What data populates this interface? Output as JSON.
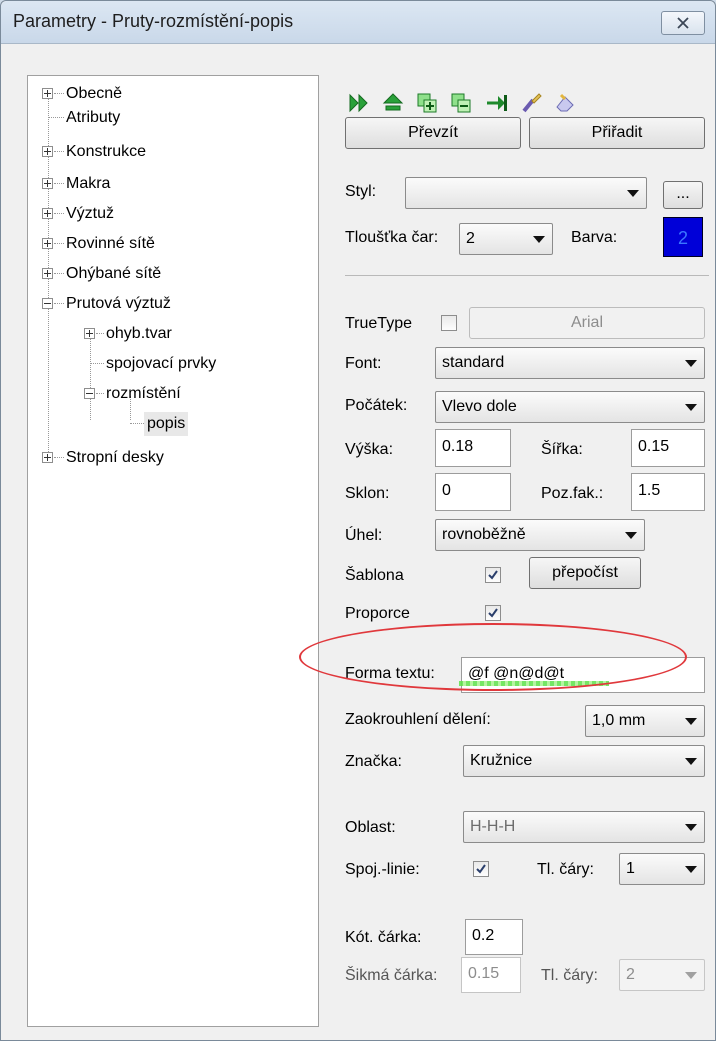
{
  "window": {
    "title": "Parametry - Pruty-rozmístění-popis",
    "close_icon": "close-icon"
  },
  "tree": {
    "items": [
      {
        "label": "Obecně"
      },
      {
        "label": "Atributy"
      },
      {
        "label": "Konstrukce"
      },
      {
        "label": "Makra"
      },
      {
        "label": "Výztuž"
      },
      {
        "label": "Rovinné sítě"
      },
      {
        "label": "Ohýbané sítě"
      },
      {
        "label": "Prutová výztuž"
      },
      {
        "label": "ohyb.tvar"
      },
      {
        "label": "spojovací prvky"
      },
      {
        "label": "rozmístění"
      },
      {
        "label": "popis"
      },
      {
        "label": "Stropní desky"
      }
    ]
  },
  "toolbar": {
    "icons": [
      "double-arrow-right-icon",
      "move-top-icon",
      "add-grid-icon",
      "remove-grid-icon",
      "pin-icon",
      "brush-icon",
      "eraser-icon"
    ]
  },
  "buttons": {
    "prevzit": "Převzít",
    "priradit": "Přiřadit",
    "ellipsis": "...",
    "arial": "Arial",
    "prepocist": "přepočíst"
  },
  "style": {
    "label": "Styl:",
    "value": ""
  },
  "line_thickness": {
    "label": "Tloušťka čar:",
    "value": "2"
  },
  "color": {
    "label": "Barva:",
    "value": "2",
    "hex": "#0000d8"
  },
  "truetype": {
    "label": "TrueType",
    "checked": false
  },
  "font": {
    "label": "Font:",
    "value": "standard"
  },
  "origin": {
    "label": "Počátek:",
    "value": "Vlevo dole"
  },
  "height": {
    "label": "Výška:",
    "value": "0.18"
  },
  "width": {
    "label": "Šířka:",
    "value": "0.15"
  },
  "slant": {
    "label": "Sklon:",
    "value": "0"
  },
  "pos_factor": {
    "label": "Poz.fak.:",
    "value": "1.5"
  },
  "angle": {
    "label": "Úhel:",
    "value": "rovnoběžně"
  },
  "template": {
    "label": "Šablona",
    "checked": true
  },
  "proportion": {
    "label": "Proporce",
    "checked": true
  },
  "text_form": {
    "label": "Forma textu:",
    "value": "@f @n@d@t"
  },
  "rounding": {
    "label": "Zaokrouhlení dělení:",
    "value": "1,0 mm"
  },
  "mark": {
    "label": "Značka:",
    "value": "Kružnice"
  },
  "area": {
    "label": "Oblast:",
    "value": "H-H-H"
  },
  "connection_line": {
    "label": "Spoj.-linie:",
    "checked": true
  },
  "line_thickness_2": {
    "label": "Tl. čáry:",
    "value": "1"
  },
  "dim_tick": {
    "label": "Kót. čárka:",
    "value": "0.2"
  },
  "oblique_tick": {
    "label": "Šikmá čárka:",
    "value": "0.15"
  },
  "line_thickness_3": {
    "label": "Tl. čáry:",
    "value": "2"
  }
}
